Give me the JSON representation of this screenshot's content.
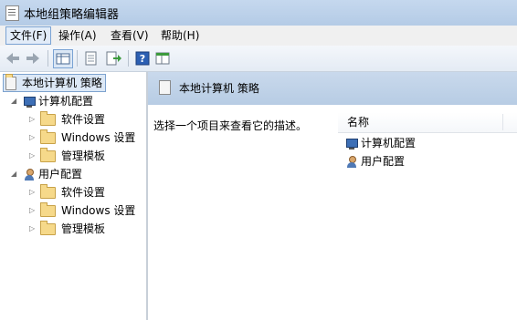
{
  "window": {
    "title": "本地组策略编辑器",
    "icon": "policy-doc-icon"
  },
  "menu": [
    {
      "label": "文件(F)",
      "active": true
    },
    {
      "label": "操作(A)"
    },
    {
      "label": "查看(V)"
    },
    {
      "label": "帮助(H)"
    }
  ],
  "toolbar": {
    "buttons": [
      "back-arrow-icon",
      "forward-arrow-icon",
      "show-hide-tree-icon",
      "properties-icon",
      "export-list-icon",
      "help-icon",
      "extended-view-icon"
    ]
  },
  "tree": {
    "root": "本地计算机 策略",
    "computer": {
      "label": "计算机配置",
      "children": [
        "软件设置",
        "Windows 设置",
        "管理模板"
      ]
    },
    "user": {
      "label": "用户配置",
      "children": [
        "软件设置",
        "Windows 设置",
        "管理模板"
      ]
    }
  },
  "content": {
    "header_title": "本地计算机 策略",
    "description": "选择一个项目来查看它的描述。",
    "column_name": "名称",
    "items": [
      "计算机配置",
      "用户配置"
    ]
  }
}
